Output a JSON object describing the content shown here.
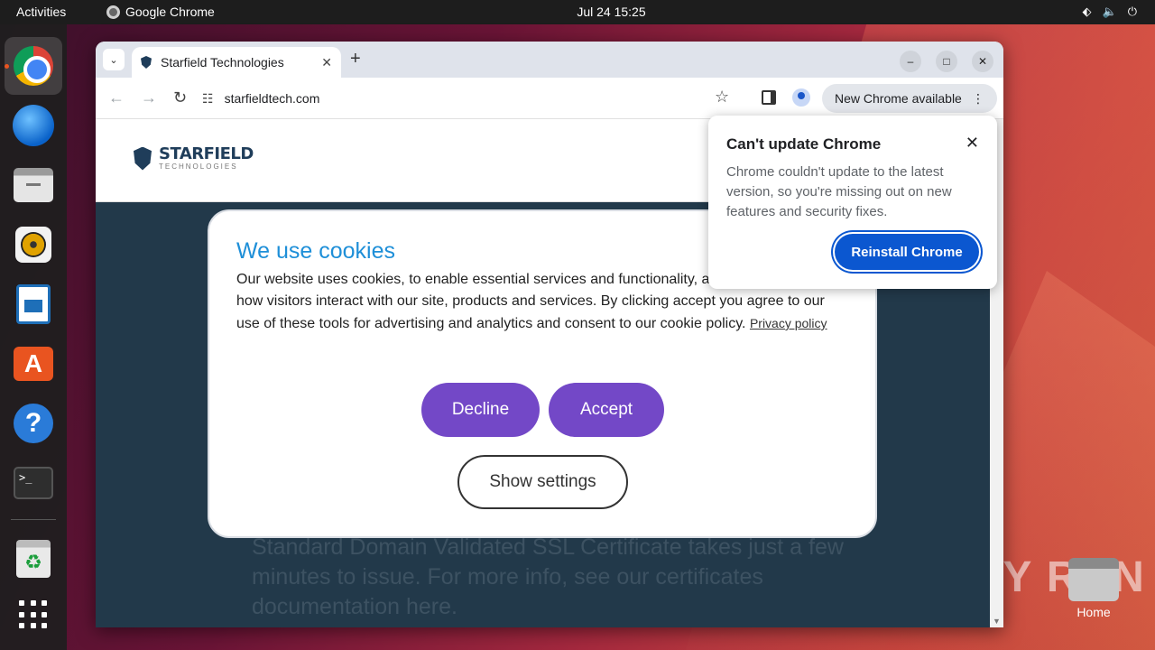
{
  "topbar": {
    "activities": "Activities",
    "app_name": "Google Chrome",
    "clock": "Jul 24  15:25"
  },
  "dock": {
    "items": [
      "chrome-icon",
      "thunderbird-icon",
      "files-icon",
      "rhythmbox-icon",
      "writer-icon",
      "app-center-icon",
      "help-icon",
      "terminal-icon",
      "trash-icon",
      "show-apps-icon"
    ]
  },
  "desktop": {
    "home_label": "Home",
    "watermark": "ANY RUN"
  },
  "browser": {
    "tab_title": "Starfield Technologies",
    "url": "starfieldtech.com",
    "update_chip": "New Chrome available"
  },
  "site": {
    "brand": "STARFIELD",
    "brand_sub": "TECHNOLOGIES",
    "bg_text": "Standard Domain Validated SSL Certificate takes just a few minutes to issue. For more info, see our certificates documentation here."
  },
  "cookie": {
    "title": "We use cookies",
    "body": "Our website uses cookies, to enable essential services and functionality, and to collect data on how visitors interact with our site, products and services. By clicking accept you agree to our use of these tools for advertising and analytics and consent to our cookie policy.",
    "privacy_link": "Privacy policy",
    "decline": "Decline",
    "accept": "Accept",
    "settings": "Show settings"
  },
  "update_popup": {
    "title": "Can't update Chrome",
    "body": "Chrome couldn't update to the latest version, so you're missing out on new features and security fixes.",
    "button": "Reinstall Chrome"
  },
  "colors": {
    "accent_purple": "#7348c7",
    "chrome_blue": "#0b57d0",
    "site_dark": "#22394a"
  }
}
